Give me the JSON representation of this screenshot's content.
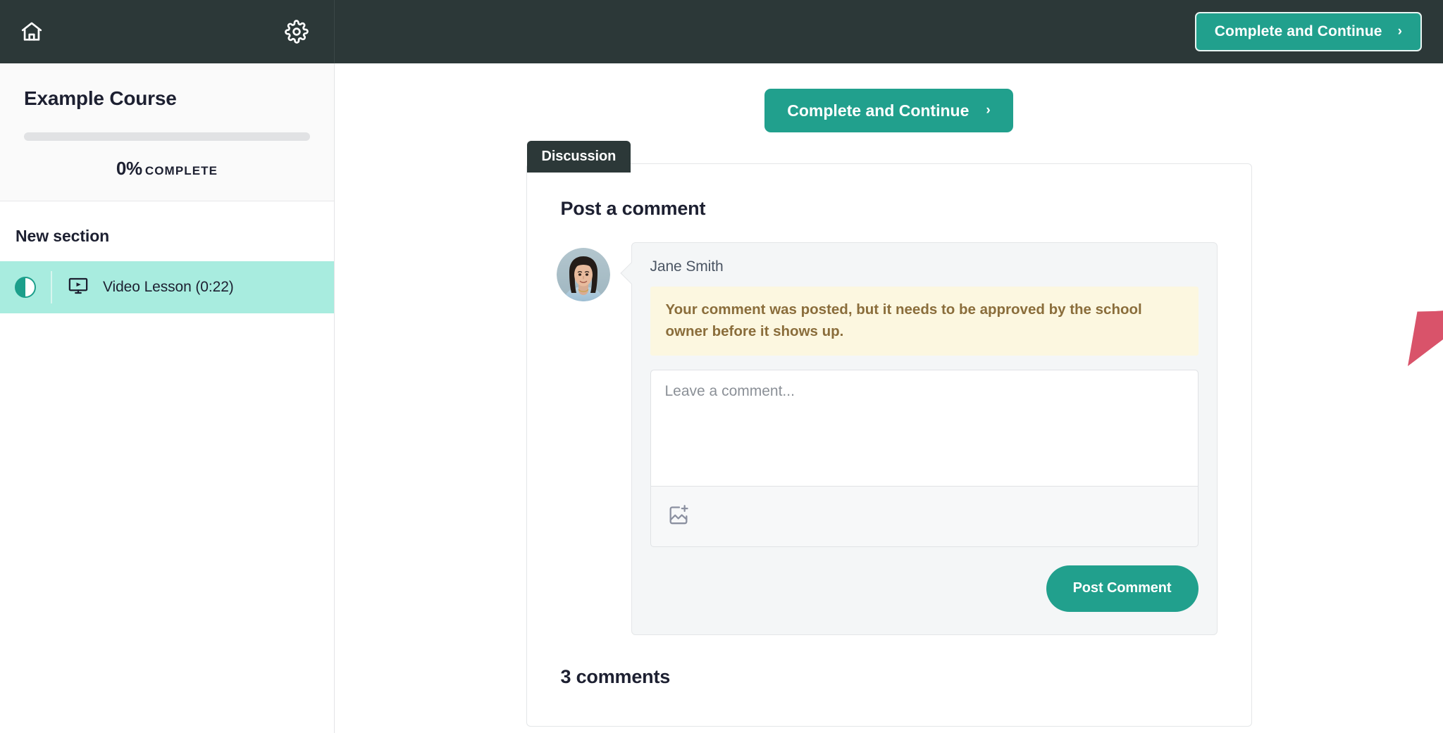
{
  "topbar": {
    "home_icon": "home-icon",
    "settings_icon": "gear-icon",
    "complete_continue_label": "Complete and Continue",
    "chevron": "›"
  },
  "sidebar": {
    "course_title": "Example Course",
    "progress_percent": 0,
    "progress_value": "0%",
    "progress_word": "COMPLETE",
    "section_title": "New section",
    "lessons": [
      {
        "label": "Video Lesson (0:22)",
        "status_icon": "half-circle-progress-icon",
        "type_icon": "video-lesson-icon",
        "active": true
      }
    ]
  },
  "main": {
    "complete_continue_label": "Complete and Continue",
    "chevron": "›",
    "tab_label": "Discussion",
    "card_title": "Post a comment",
    "compose": {
      "avatar_icon": "user-avatar-photo",
      "author": "Jane Smith",
      "alert_text": "Your comment was posted, but it needs to be approved by the school owner before it shows up.",
      "textarea_value": "",
      "textarea_placeholder": "Leave a comment...",
      "attach_image_icon": "add-image-icon",
      "post_button_label": "Post Comment"
    },
    "comments_count_label": "3 comments"
  },
  "annotation": {
    "arrow_icon": "red-pointer-arrow",
    "arrow_color": "#d9536a"
  },
  "colors": {
    "dark": "#2c3838",
    "teal": "#21a08d",
    "teal_light": "#a8ecdf",
    "alert_bg": "#fcf7e0",
    "alert_text": "#8a6d3b",
    "arrow": "#d9536a"
  }
}
